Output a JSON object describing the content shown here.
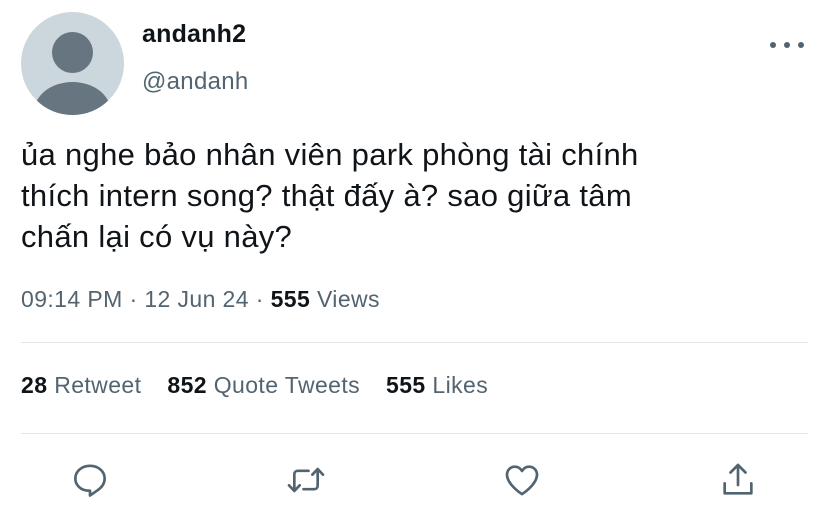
{
  "user": {
    "display_name": "andanh2",
    "handle": "@andanh"
  },
  "tweet": {
    "lines": [
      "ủa nghe bảo nhân viên park phòng tài chính",
      "thích intern song? thật đấy à? sao giữa tâm",
      "chấn lại có vụ này?"
    ]
  },
  "meta": {
    "time": "09:14 PM",
    "sep1": "·",
    "date": "12 Jun 24",
    "sep2": "·",
    "views_count": "555",
    "views_label": "Views"
  },
  "stats": {
    "retweets_count": "28",
    "retweets_label": "Retweet",
    "quotes_count": "852",
    "quotes_label": "Quote Tweets",
    "likes_count": "555",
    "likes_label": "Likes"
  },
  "icons": {
    "more": "more-horizontal-icon",
    "reply": "reply-icon",
    "retweet": "retweet-icon",
    "like": "heart-icon",
    "share": "share-icon"
  },
  "colors": {
    "text_primary": "#0f1419",
    "text_secondary": "#536471",
    "divider": "#e1e6ea",
    "avatar_bg": "#ccd6dd",
    "avatar_fg": "#66757f"
  }
}
